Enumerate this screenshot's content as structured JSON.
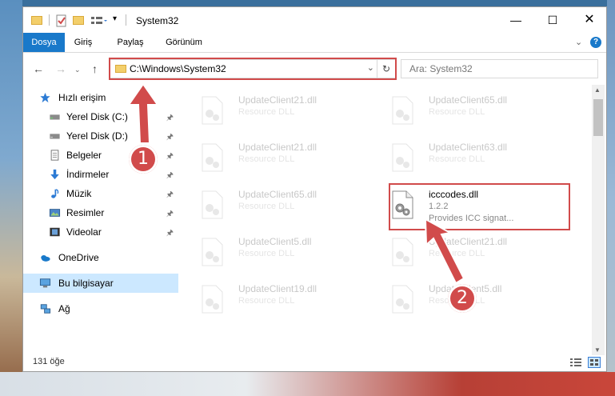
{
  "window": {
    "title": "System32"
  },
  "ribbon": {
    "tabs": [
      {
        "label": "Dosya",
        "active": true
      },
      {
        "label": "Giriş"
      },
      {
        "label": "Paylaş"
      },
      {
        "label": "Görünüm"
      }
    ]
  },
  "address": {
    "path": "C:\\Windows\\System32",
    "search_placeholder": "Ara: System32"
  },
  "nav": {
    "quick_access": "Hızlı erişim",
    "items": [
      {
        "label": "Yerel Disk (C:)",
        "icon": "drive-icon"
      },
      {
        "label": "Yerel Disk (D:)",
        "icon": "drive-icon"
      },
      {
        "label": "Belgeler",
        "icon": "documents-icon"
      },
      {
        "label": "İndirmeler",
        "icon": "download-icon"
      },
      {
        "label": "Müzik",
        "icon": "music-icon"
      },
      {
        "label": "Resimler",
        "icon": "pictures-icon"
      },
      {
        "label": "Videolar",
        "icon": "video-icon"
      }
    ],
    "onedrive": "OneDrive",
    "this_pc": "Bu bilgisayar",
    "network": "Ağ"
  },
  "files": {
    "left": [
      {
        "name": "UpdateClient21.dll",
        "type": "Resource DLL"
      },
      {
        "name": "UpdateClient21.dll",
        "type": "Resource DLL"
      },
      {
        "name": "UpdateClient65.dll",
        "type": "Resource DLL"
      },
      {
        "name": "UpdateClient5.dll",
        "type": "Resource DLL"
      },
      {
        "name": "UpdateClient19.dll",
        "type": "Resource DLL"
      }
    ],
    "right": [
      {
        "name": "UpdateClient65.dll",
        "type": "Resource DLL"
      },
      {
        "name": "UpdateClient63.dll",
        "type": "Resource DLL"
      },
      {
        "name": "icccodes.dll",
        "version": "1.2.2",
        "desc": "Provides ICC signat..."
      },
      {
        "name": "UpdateClient21.dll",
        "type": "Resource DLL"
      },
      {
        "name": "UpdateClient5.dll",
        "type": "Resource DLL"
      }
    ]
  },
  "status": {
    "count": "131 öğe"
  },
  "annotations": {
    "step1": "1",
    "step2": "2"
  },
  "colors": {
    "accent": "#1979ca",
    "highlight": "#d14b4b",
    "selected": "#cce8ff"
  }
}
